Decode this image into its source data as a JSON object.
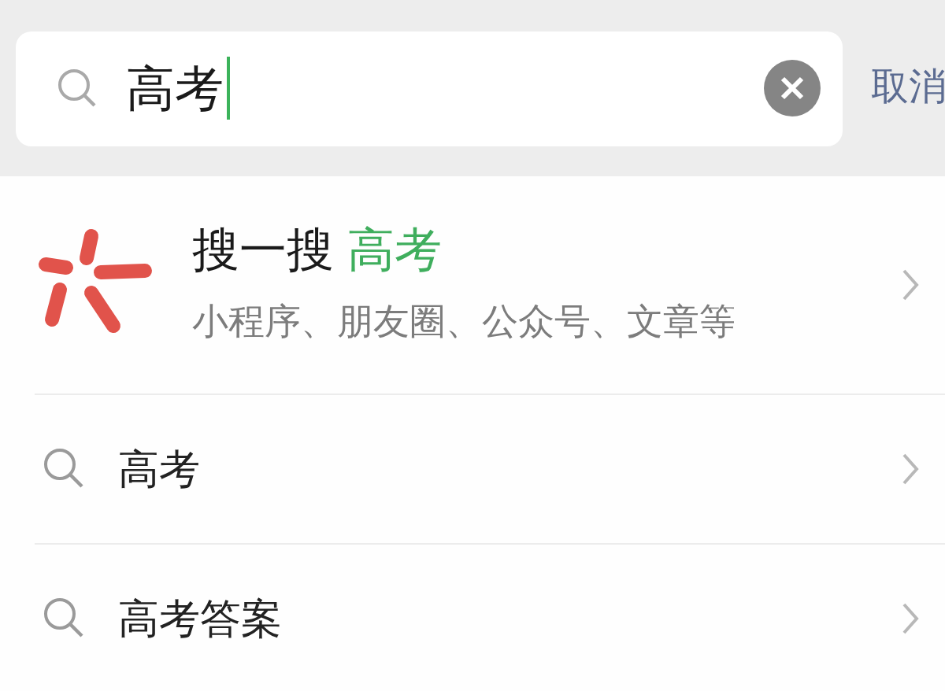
{
  "search": {
    "value": "高考",
    "cancel": "取消"
  },
  "featured": {
    "title": "搜一搜",
    "query": "高考",
    "subtitle": "小程序、朋友圈、公众号、文章等"
  },
  "suggestions": [
    {
      "text": "高考"
    },
    {
      "text": "高考答案"
    }
  ]
}
